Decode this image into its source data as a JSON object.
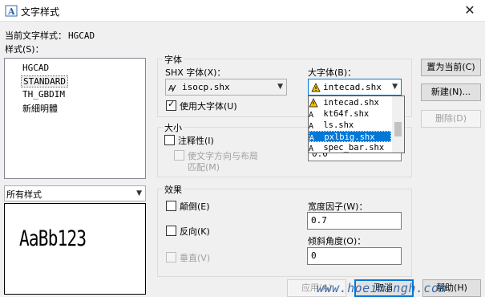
{
  "window": {
    "title": "文字样式",
    "close_glyph": "✕"
  },
  "current_style": {
    "label": "当前文字样式：",
    "value": "HGCAD"
  },
  "styles": {
    "label": "样式(S)：",
    "items": [
      "HGCAD",
      "STANDARD",
      "TH_GBDIM",
      "新細明體"
    ],
    "selected_index": 1,
    "filter": "所有样式",
    "preview_text": "AaBb123"
  },
  "font": {
    "group_label": "字体",
    "shx_label": "SHX 字体(X)：",
    "shx_value": "isocp.shx",
    "big_label": "大字体(B)：",
    "big_value": "intecad.shx",
    "use_big_font_label": "使用大字体(U)",
    "use_big_font_checked": true,
    "big_font_options": [
      "intecad.shx",
      "kt64f.shx",
      "ls.shx",
      "pxlbig.shx",
      "spec_bar.shx"
    ],
    "big_font_highlight_index": 3
  },
  "size": {
    "group_label": "大小",
    "annotative_label": "注释性(I)",
    "match_orientation_label_1": "使文字方向与布局",
    "match_orientation_label_2": "匹配(M)",
    "height_value": "0.0"
  },
  "effects": {
    "group_label": "效果",
    "upside_down_label": "颠倒(E)",
    "backwards_label": "反向(K)",
    "vertical_label": "垂直(V)",
    "width_factor_label": "宽度因子(W)：",
    "width_factor_value": "0.7",
    "oblique_label": "倾斜角度(O)：",
    "oblique_value": "0"
  },
  "buttons": {
    "set_current": "置为当前(C)",
    "new": "新建(N)...",
    "delete": "删除(D)",
    "apply": "应用(A)",
    "cancel": "取消",
    "help": "帮助(H)"
  },
  "watermark": "www.hoeimingh.com",
  "colors": {
    "accent": "#0078d7",
    "warning": "#f2c500"
  }
}
